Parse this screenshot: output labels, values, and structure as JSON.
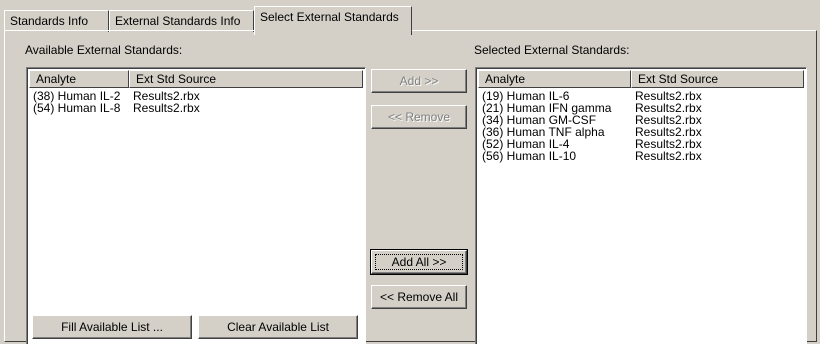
{
  "tabs": [
    {
      "label": "Standards Info"
    },
    {
      "label": "External Standards Info"
    },
    {
      "label": "Select External Standards"
    }
  ],
  "available": {
    "label": "Available External Standards:",
    "columns": [
      "Analyte",
      "Ext Std Source"
    ],
    "rows": [
      {
        "analyte": "(38) Human IL-2",
        "source": "Results2.rbx"
      },
      {
        "analyte": "(54) Human IL-8",
        "source": "Results2.rbx"
      }
    ]
  },
  "selected": {
    "label": "Selected External Standards:",
    "columns": [
      "Analyte",
      "Ext Std Source"
    ],
    "rows": [
      {
        "analyte": "(19) Human IL-6",
        "source": "Results2.rbx"
      },
      {
        "analyte": "(21) Human IFN gamma",
        "source": "Results2.rbx"
      },
      {
        "analyte": "(34) Human GM-CSF",
        "source": "Results2.rbx"
      },
      {
        "analyte": "(36) Human TNF alpha",
        "source": "Results2.rbx"
      },
      {
        "analyte": "(52) Human IL-4",
        "source": "Results2.rbx"
      },
      {
        "analyte": "(56) Human IL-10",
        "source": "Results2.rbx"
      }
    ]
  },
  "buttons": {
    "add": "Add >>",
    "remove": "<< Remove",
    "add_all": "Add All >>",
    "remove_all": "<< Remove All",
    "fill_available": "Fill Available List ...",
    "clear_available": "Clear Available List"
  }
}
